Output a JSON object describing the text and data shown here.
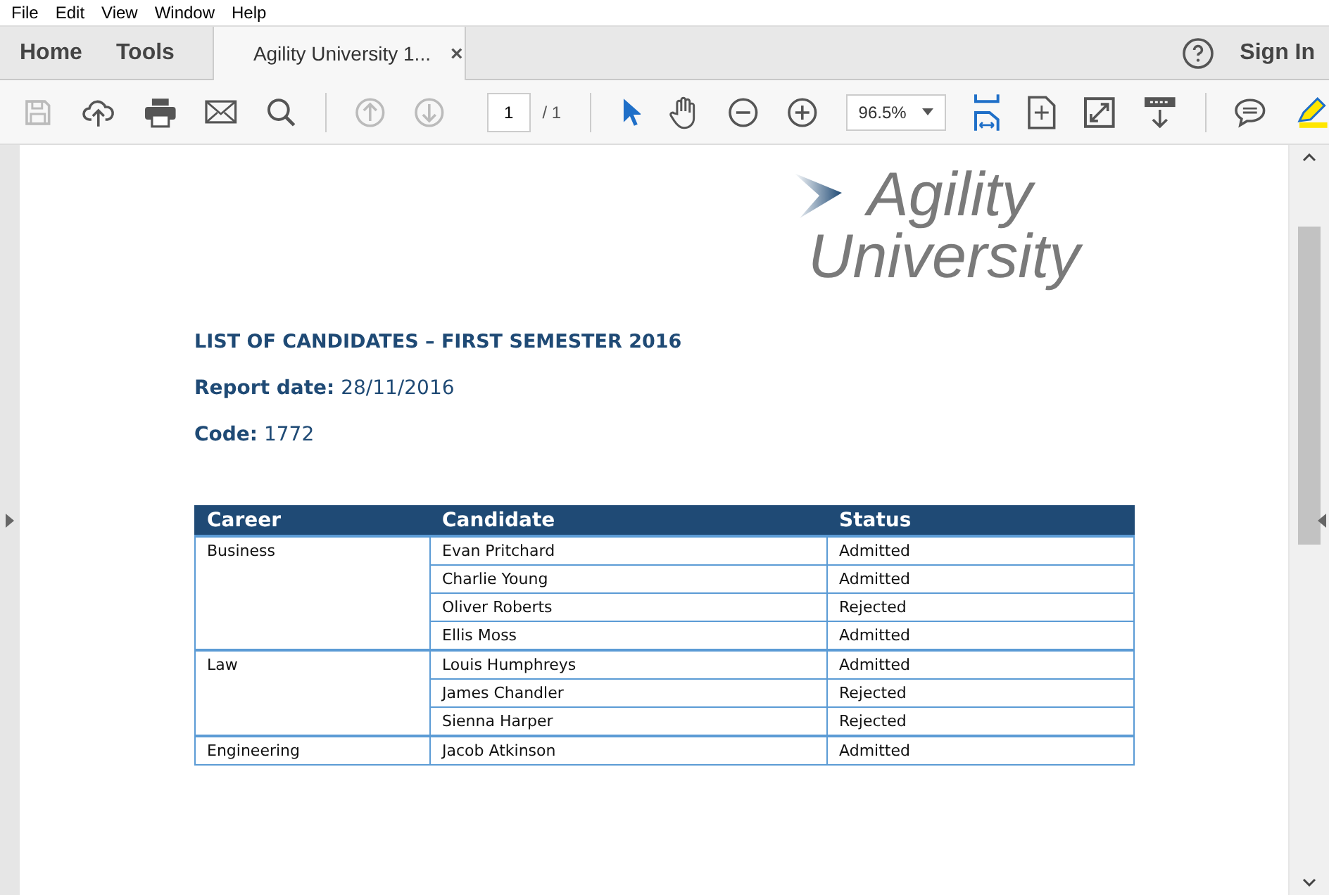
{
  "menu": [
    "File",
    "Edit",
    "View",
    "Window",
    "Help"
  ],
  "nav_tabs": [
    "Home",
    "Tools"
  ],
  "document_tab": {
    "title": "Agility University 1...",
    "close": "×"
  },
  "sign_in": "Sign In",
  "toolbar": {
    "page": "1",
    "page_total": "/ 1",
    "zoom": "96.5%"
  },
  "document": {
    "logo": {
      "line1": "Agility",
      "line2": "University"
    },
    "title": "LIST OF CANDIDATES – FIRST SEMESTER 2016",
    "report_date": {
      "label": "Report date:",
      "value": "28/11/2016"
    },
    "code": {
      "label": "Code:",
      "value": "1772"
    },
    "table": {
      "columns": [
        "Career",
        "Candidate",
        "Status"
      ],
      "groups": [
        {
          "career": "Business",
          "candidates": [
            {
              "name": "Evan Pritchard",
              "status": "Admitted"
            },
            {
              "name": "Charlie Young",
              "status": "Admitted"
            },
            {
              "name": "Oliver Roberts",
              "status": "Rejected"
            },
            {
              "name": "Ellis Moss",
              "status": "Admitted"
            }
          ]
        },
        {
          "career": "Law",
          "candidates": [
            {
              "name": "Louis Humphreys",
              "status": "Admitted"
            },
            {
              "name": "James Chandler",
              "status": "Rejected"
            },
            {
              "name": "Sienna Harper",
              "status": "Rejected"
            }
          ]
        },
        {
          "career": "Engineering",
          "candidates": [
            {
              "name": "Jacob Atkinson",
              "status": "Admitted"
            }
          ]
        }
      ]
    }
  }
}
